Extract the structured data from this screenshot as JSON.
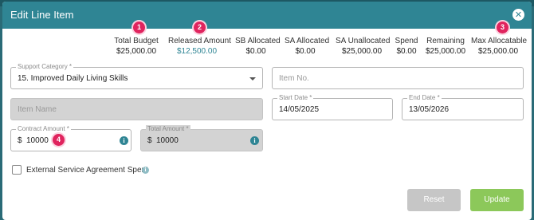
{
  "dialog": {
    "title": "Edit Line Item",
    "close_icon": "close-icon"
  },
  "stats": [
    {
      "label": "Total Budget",
      "value": "$25,000.00"
    },
    {
      "label": "Released Amount",
      "value": "$12,500.00"
    },
    {
      "label": "SB Allocated",
      "value": "$0.00"
    },
    {
      "label": "SA Allocated",
      "value": "$0.00"
    },
    {
      "label": "SA Unallocated",
      "value": "$25,000.00"
    },
    {
      "label": "Spend",
      "value": "$0.00"
    },
    {
      "label": "Remaining",
      "value": "$25,000.00"
    },
    {
      "label": "Max Allocatable",
      "value": "$25,000.00"
    }
  ],
  "badges": {
    "b1": "1",
    "b2": "2",
    "b3": "3",
    "b4": "4"
  },
  "form": {
    "support_category": {
      "label": "Support Category *",
      "value": "15. Improved Daily Living Skills"
    },
    "item_no": {
      "placeholder": "Item No."
    },
    "item_name": {
      "placeholder": "Item Name"
    },
    "start_date": {
      "label": "Start Date *",
      "value": "14/05/2025"
    },
    "end_date": {
      "label": "End Date *",
      "value": "13/05/2026"
    },
    "contract_amount": {
      "label": "Contract Amount *",
      "currency": "$",
      "value": "10000"
    },
    "total_amount": {
      "label": "Total Amount *",
      "currency": "$",
      "value": "10000"
    },
    "external_agreement": {
      "label": "External Service Agreement Spent",
      "checked": false
    }
  },
  "buttons": {
    "reset": "Reset",
    "update": "Update"
  },
  "colors": {
    "header": "#2f8594",
    "badge": "#e0245e",
    "update": "#8cc85a",
    "reset": "#c6c6c6"
  }
}
